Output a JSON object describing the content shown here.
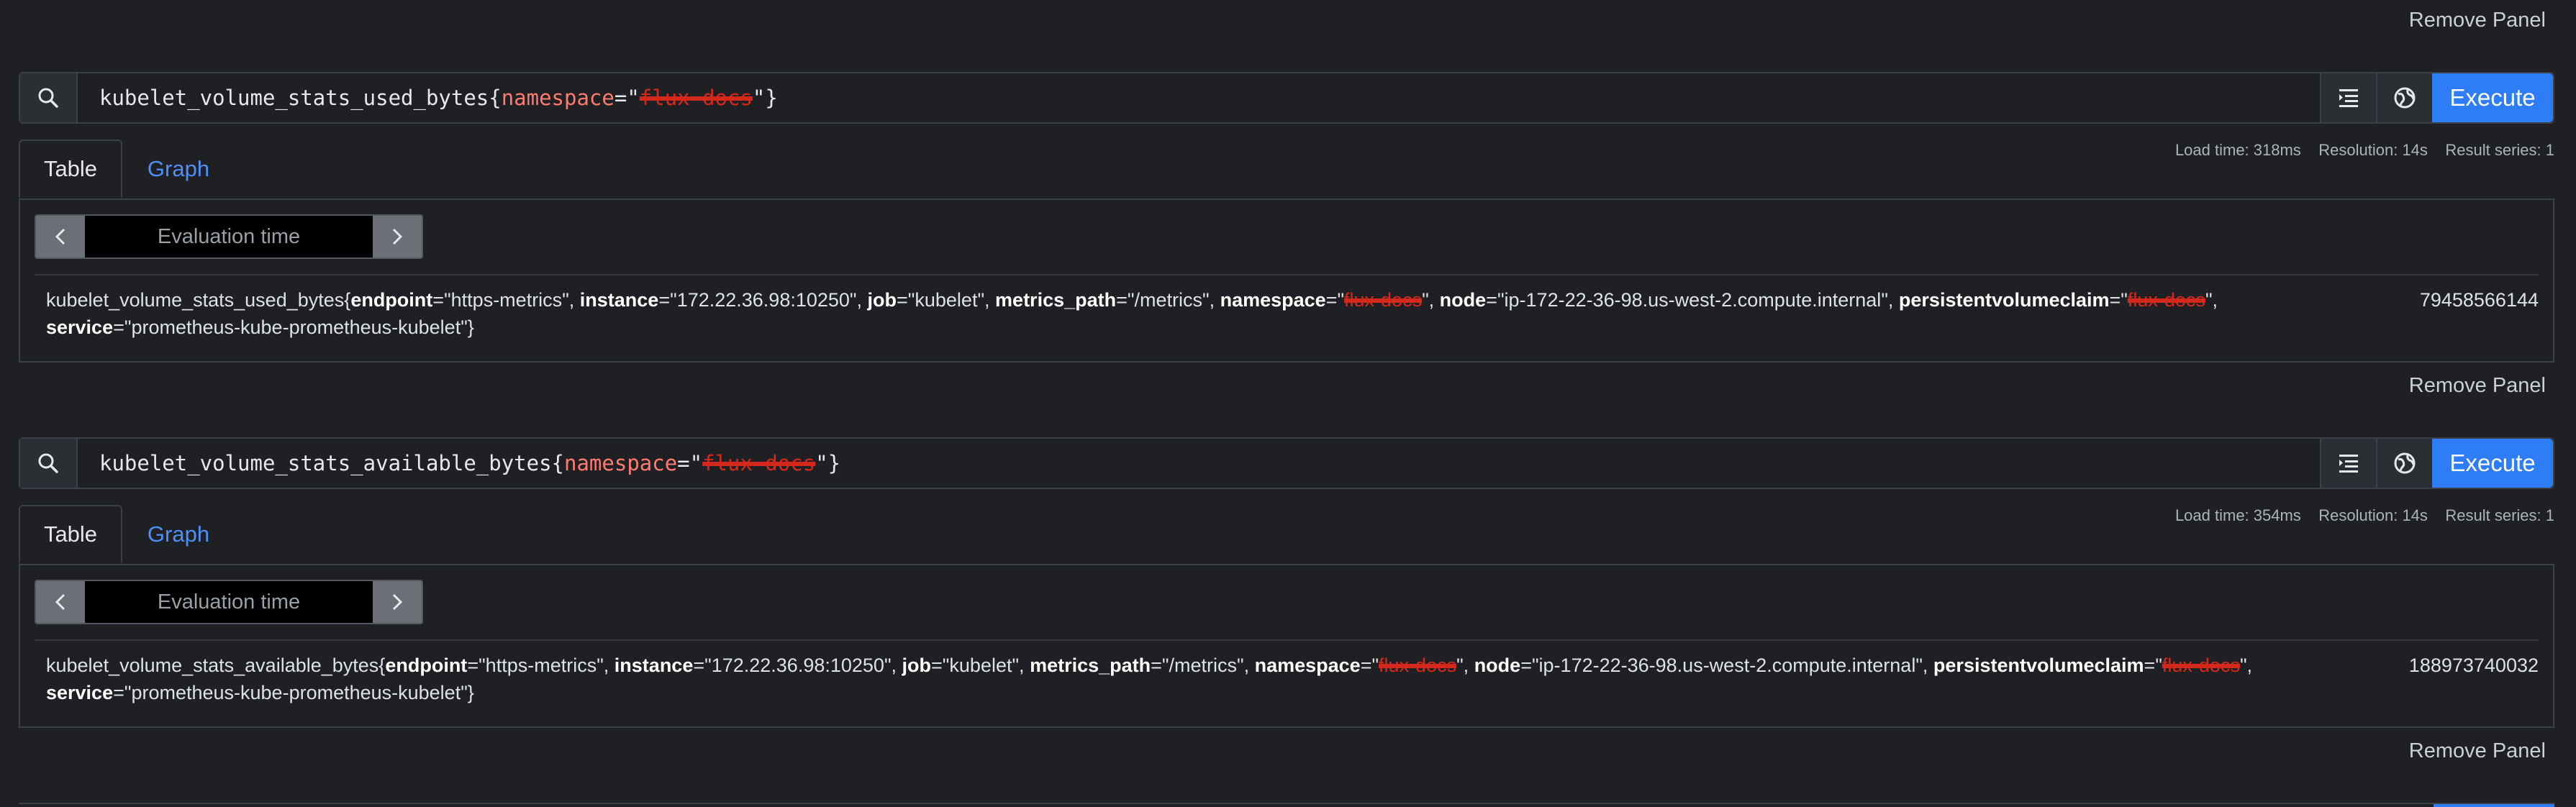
{
  "remove_panel_label": "Remove Panel",
  "panels": [
    {
      "expr_metric": "kubelet_volume_stats_used_bytes",
      "expr_label_key": "namespace",
      "expr_redacted": "flux-docs",
      "execute_label": "Execute",
      "tabs": [
        "Table",
        "Graph"
      ],
      "load_time": "Load time: 318ms",
      "resolution": "Resolution: 14s",
      "result_series": "Result series: 1",
      "eval_placeholder": "Evaluation time",
      "series": {
        "metric": "kubelet_volume_stats_used_bytes",
        "endpoint": "https-metrics",
        "instance": "172.22.36.98:10250",
        "job": "kubelet",
        "metrics_path": "/metrics",
        "namespace_redacted": "flux-docs",
        "node": "ip-172-22-36-98.us-west-2.compute.internal",
        "pvc_redacted": "flux-docs",
        "service": "prometheus-kube-prometheus-kubelet"
      },
      "value": "79458566144"
    },
    {
      "expr_metric": "kubelet_volume_stats_available_bytes",
      "expr_label_key": "namespace",
      "expr_redacted": "flux-docs",
      "execute_label": "Execute",
      "tabs": [
        "Table",
        "Graph"
      ],
      "load_time": "Load time: 354ms",
      "resolution": "Resolution: 14s",
      "result_series": "Result series: 1",
      "eval_placeholder": "Evaluation time",
      "series": {
        "metric": "kubelet_volume_stats_available_bytes",
        "endpoint": "https-metrics",
        "instance": "172.22.36.98:10250",
        "job": "kubelet",
        "metrics_path": "/metrics",
        "namespace_redacted": "flux-docs",
        "node": "ip-172-22-36-98.us-west-2.compute.internal",
        "pvc_redacted": "flux-docs",
        "service": "prometheus-kube-prometheus-kubelet"
      },
      "value": "188973740032"
    }
  ],
  "colors": {
    "background": "#1e2024",
    "accent": "#2f7df6",
    "label_red": "#ff7b72",
    "redaction": "#d4281c",
    "link_blue": "#4f8ff7"
  },
  "icons": {
    "search": "search-icon",
    "format": "format-expression-icon",
    "explorer": "metrics-explorer-icon",
    "prev": "chevron-left-icon",
    "next": "chevron-right-icon"
  }
}
